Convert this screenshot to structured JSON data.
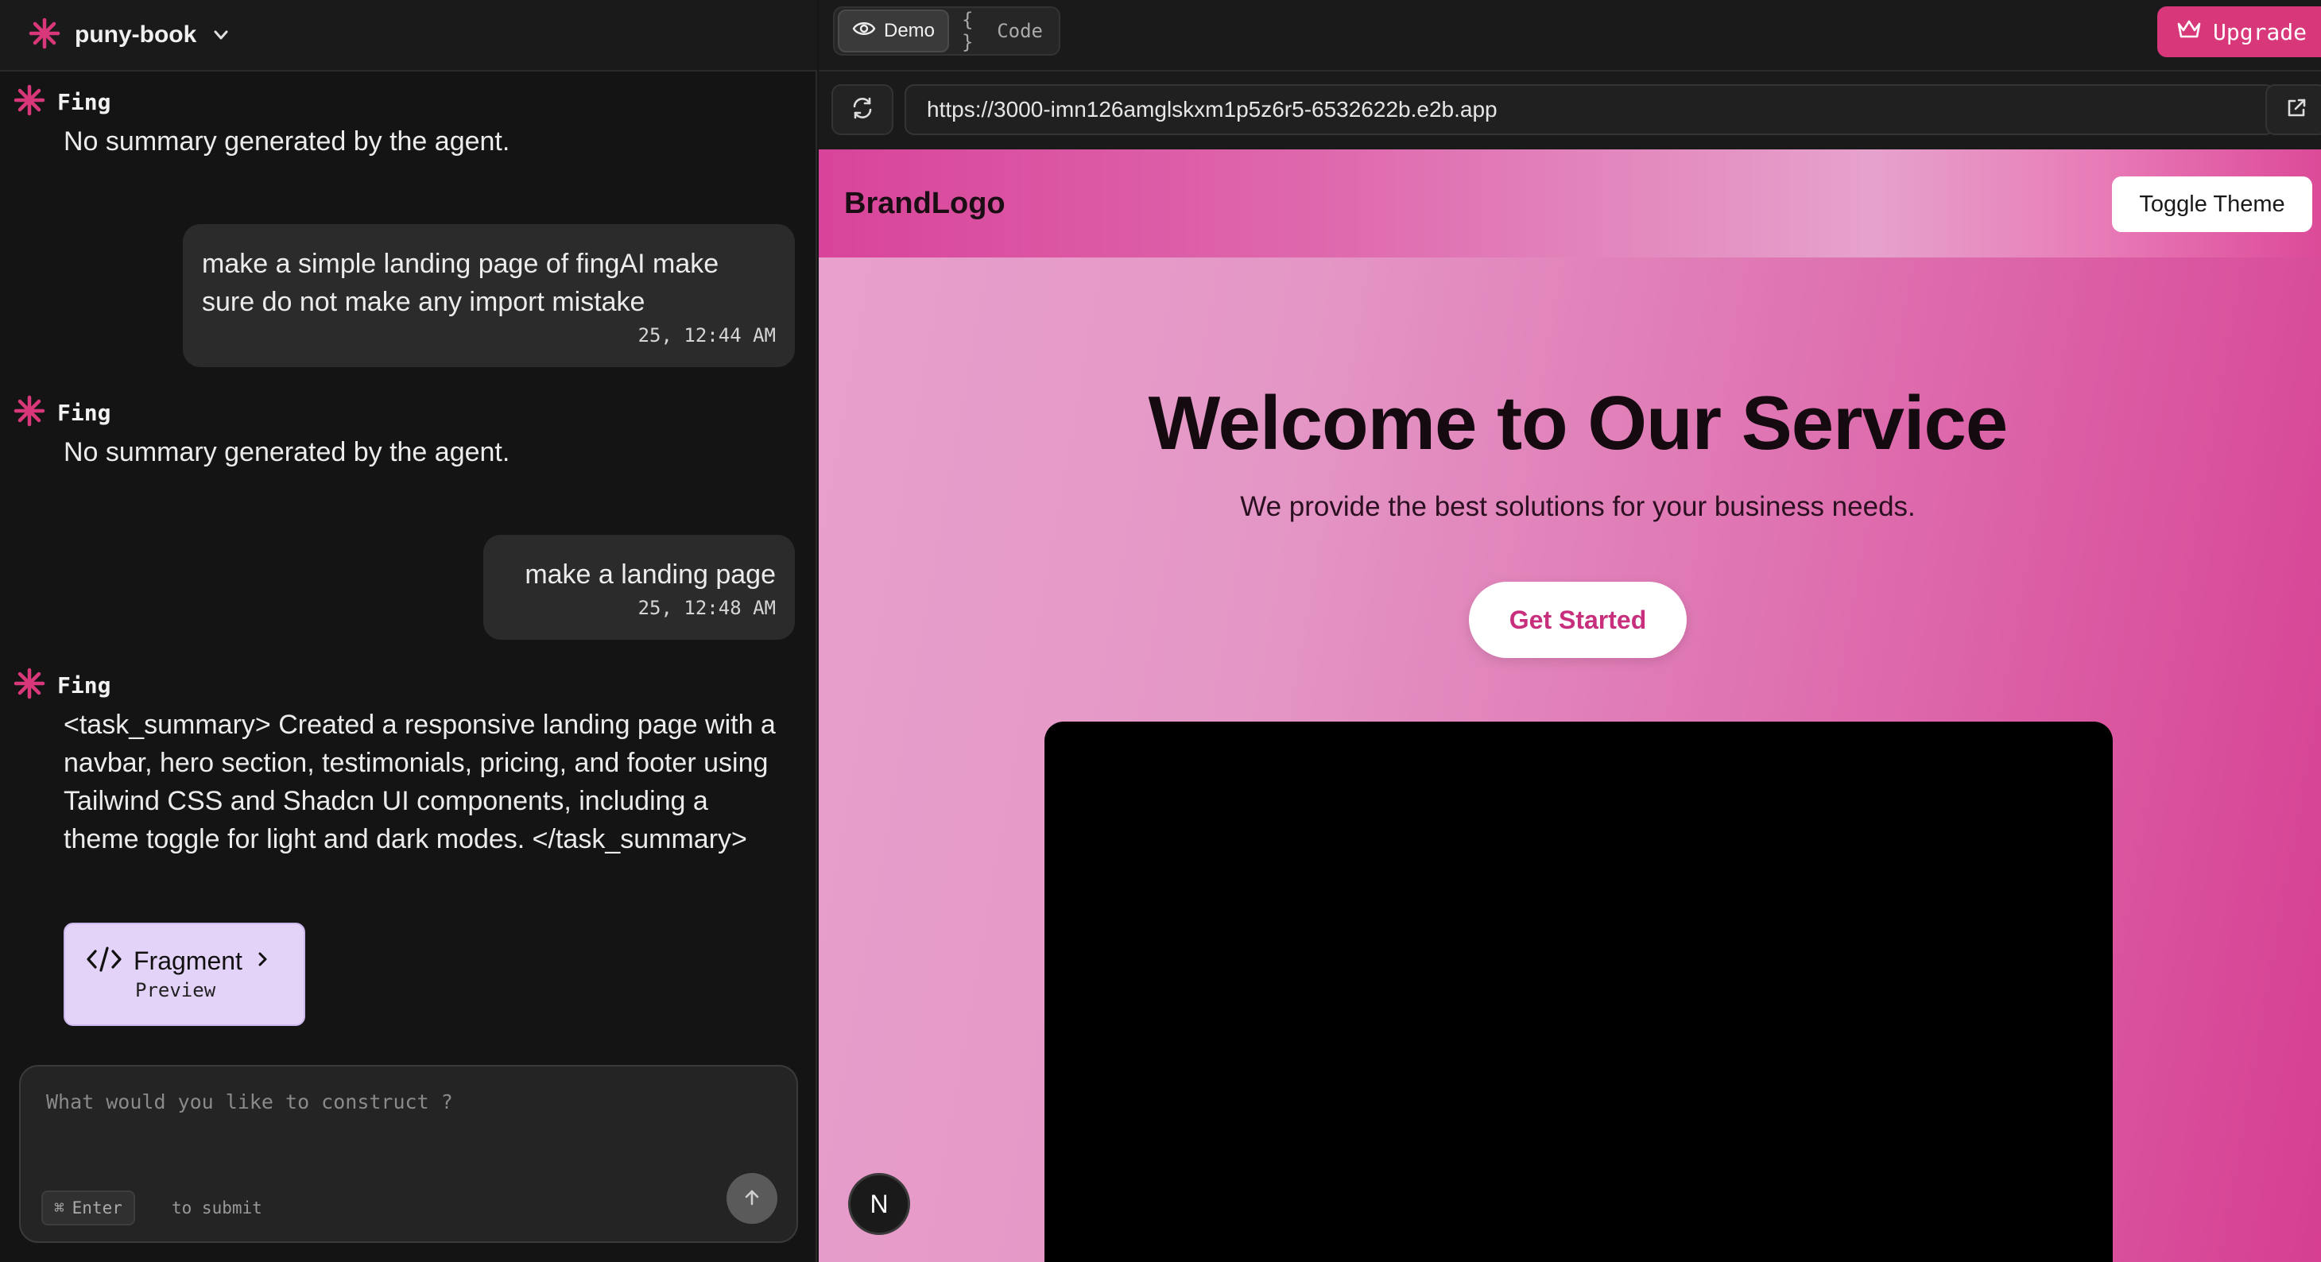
{
  "project": {
    "name": "puny-book"
  },
  "messages": [
    {
      "role": "agent",
      "sender": "Fing",
      "text": "No summary generated by the agent."
    },
    {
      "role": "user",
      "text": "make a simple landing page of fingAI make sure do not make any import mistake",
      "time": "25, 12:44 AM"
    },
    {
      "role": "agent",
      "sender": "Fing",
      "text": "No summary generated by the agent."
    },
    {
      "role": "user",
      "text": "make a landing page",
      "time": "25, 12:48 AM"
    },
    {
      "role": "agent",
      "sender": "Fing",
      "text": "<task_summary> Created a responsive landing page with a navbar, hero section, testimonials, pricing, and footer using Tailwind CSS and Shadcn UI components, including a theme toggle for light and dark modes. </task_summary>"
    }
  ],
  "fragment": {
    "title": "Fragment",
    "subtitle": "Preview"
  },
  "composer": {
    "placeholder": "What would you like to construct ?",
    "key_label": "Enter",
    "hint": "to submit"
  },
  "tabs": {
    "demo": "Demo",
    "code": "Code"
  },
  "upgrade_label": "Upgrade",
  "url": "https://3000-imn126amglskxm1p5z6r5-6532622b.e2b.app",
  "site": {
    "brand": "BrandLogo",
    "toggle_label": "Toggle Theme",
    "hero_title": "Welcome to Our Service",
    "hero_subtitle": "We provide the best solutions for your business needs.",
    "cta_label": "Get Started",
    "badge": "N"
  },
  "colors": {
    "accent": "#d8387a",
    "agent_logo": "#d8387a",
    "fragment_bg": "#e3d3f8",
    "cta_text": "#c72f7d"
  },
  "icons": {
    "agent": "asterisk-logo-icon",
    "dropdown": "chevron-down-icon",
    "demo": "eye-icon",
    "code": "braces-icon",
    "upgrade": "crown-icon",
    "refresh": "refresh-icon",
    "open": "external-link-icon",
    "fragment": "code-icon",
    "send": "arrow-up-icon",
    "cmd": "command-key-icon"
  }
}
